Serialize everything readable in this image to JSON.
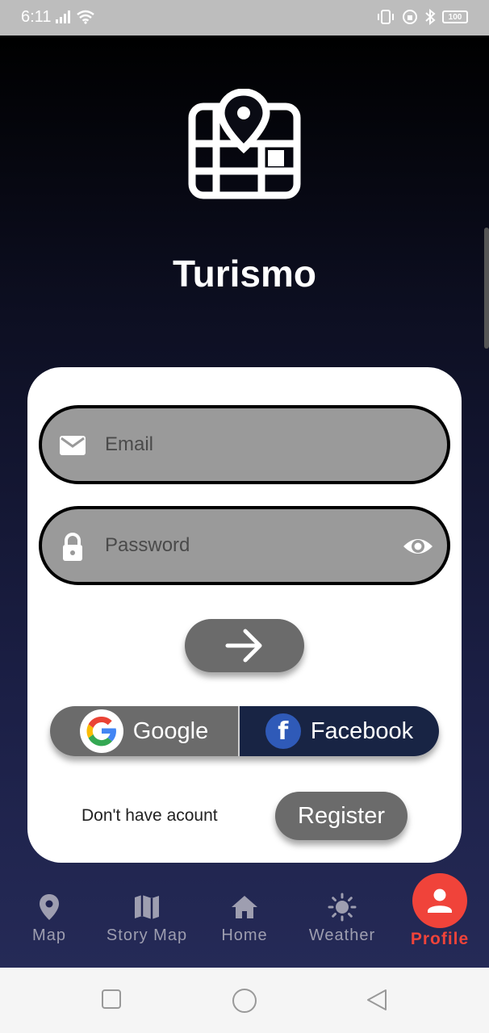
{
  "status_bar": {
    "time": "6:11",
    "battery": "100",
    "icons": [
      "signal-icon",
      "wifi-icon",
      "vibrate-icon",
      "hotspot-icon",
      "bluetooth-icon",
      "battery-icon"
    ]
  },
  "app": {
    "title": "Turismo",
    "logo_icon": "map-pin-icon"
  },
  "login": {
    "email_placeholder": "Email",
    "password_placeholder": "Password",
    "submit_icon": "arrow-right-icon",
    "google_label": "Google",
    "facebook_label": "Facebook",
    "no_account_text": "Don't have acount",
    "register_label": "Register"
  },
  "bottom_nav": {
    "items": [
      {
        "label": "Map",
        "icon": "location-pin-icon"
      },
      {
        "label": "Story Map",
        "icon": "folded-map-icon"
      },
      {
        "label": "Home",
        "icon": "home-icon"
      },
      {
        "label": "Weather",
        "icon": "sun-icon"
      },
      {
        "label": "Profile",
        "icon": "person-icon"
      }
    ],
    "active": "Profile"
  },
  "colors": {
    "accent": "#f0433a",
    "field_bg": "#9a9a9a",
    "button_bg": "#6b6b6b",
    "facebook_bg": "#182444"
  }
}
